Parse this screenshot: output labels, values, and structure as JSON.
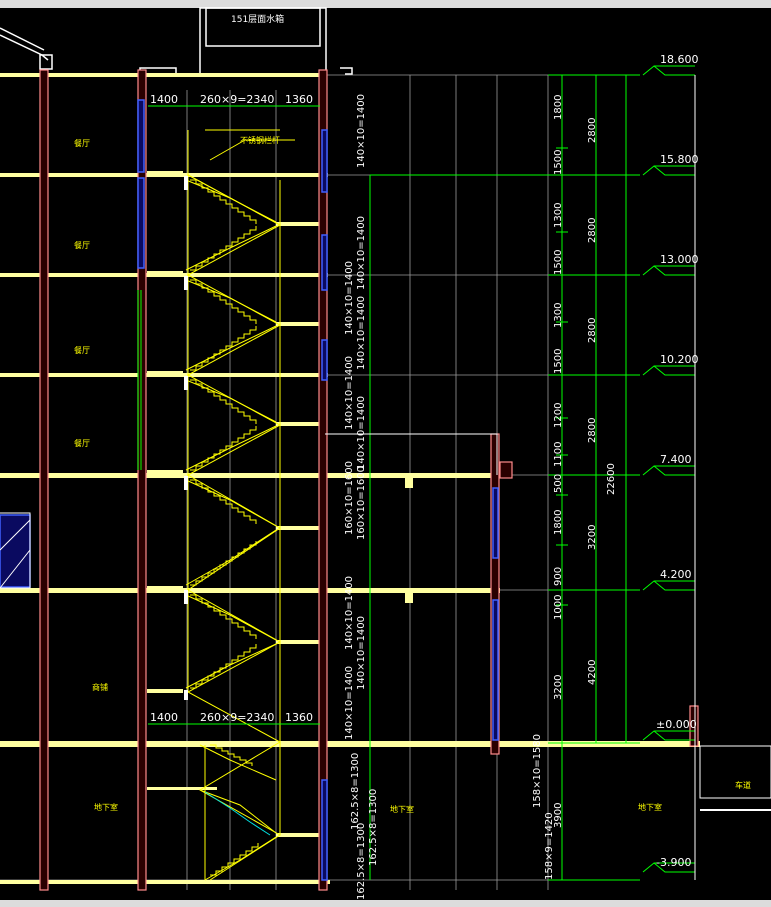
{
  "colors": {
    "background": "#000000",
    "floor_slab": "#ffff80",
    "dimension": "#00ff00",
    "stair": "#ffff00",
    "wall": "#ff8080",
    "window": "#3050ff",
    "grid": "#c0c0c0",
    "label": "#ffff00",
    "text_white": "#ffffff"
  },
  "roof_label": "151层面水箱",
  "elevations": [
    "18.600",
    "15.800",
    "13.000",
    "10.200",
    "7.400",
    "4.200",
    "±0.000",
    "-3.900"
  ],
  "room_labels": {
    "dining_1": "餐厅",
    "dining_2": "餐厅",
    "dining_3": "餐厅",
    "dining_4": "餐厅",
    "lobby": "商铺",
    "basement_1": "地下室",
    "basement_2": "地下室",
    "basement_3": "地下室",
    "outside": "车道",
    "rail_note": "不锈钢栏杆"
  },
  "plan_dims_top": [
    "1400",
    "260×9=2340",
    "1360"
  ],
  "plan_dims_bottom": [
    "1400",
    "260×9=2340",
    "1360"
  ],
  "flight_dims": [
    "140×10=1400",
    "140×10=1400",
    "140×10=1400",
    "140×10=1400",
    "140×10=1400",
    "140×10=1400",
    "140×10=1400",
    "140×10=1400",
    "160×10=1600",
    "160×10=1600",
    "160×10=1600",
    "140×10=1400",
    "140×10=1400",
    "140×10=1400",
    "162.5×8=1300",
    "162.5×8=1300",
    "162.5×8=1300",
    "158×10=1580",
    "158×9=1420"
  ],
  "seg_dims": [
    "1800",
    "1500",
    "1300",
    "1500",
    "1300",
    "1500",
    "1200",
    "1100",
    "500",
    "1800",
    "900",
    "1000",
    "3200",
    "3900"
  ],
  "story_dims": [
    "2800",
    "2800",
    "2800",
    "2800",
    "3200",
    "4200"
  ],
  "total_dim": "22600"
}
